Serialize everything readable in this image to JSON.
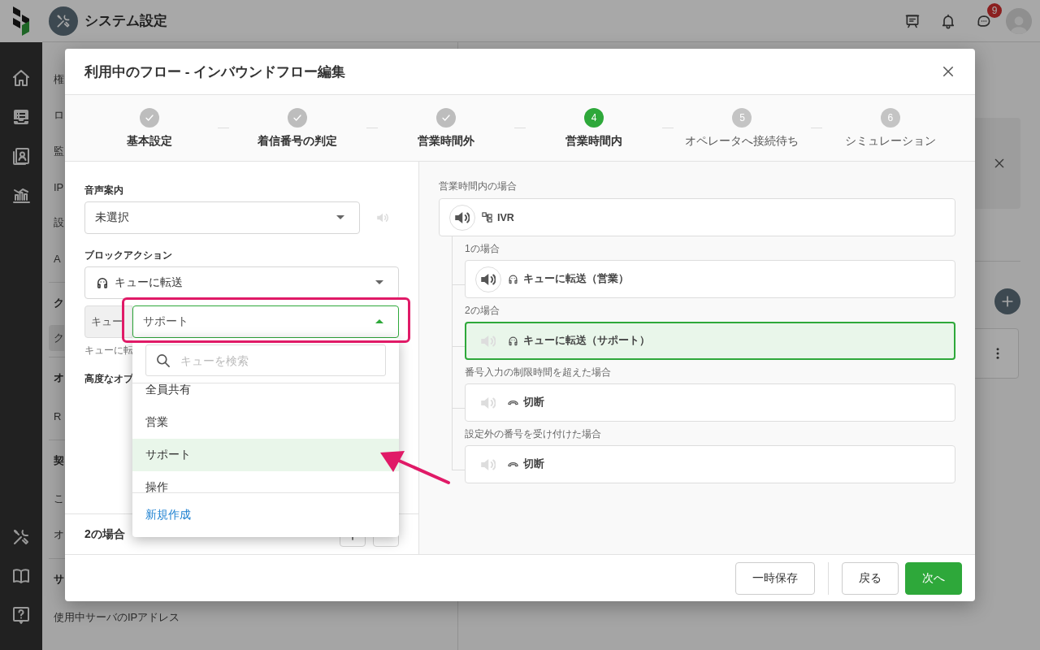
{
  "header": {
    "title": "システム設定",
    "badge": "9"
  },
  "background_sidebar": [
    {
      "label": "権",
      "kind": "item",
      "selected": false
    },
    {
      "label": "ロ",
      "kind": "item",
      "selected": false
    },
    {
      "label": "監",
      "kind": "item",
      "selected": false
    },
    {
      "label": "IP",
      "kind": "item",
      "selected": false
    },
    {
      "label": "設",
      "kind": "item",
      "selected": false
    },
    {
      "label": "A",
      "kind": "item",
      "selected": false
    },
    {
      "label": "ク",
      "kind": "heading"
    },
    {
      "label": "ク",
      "kind": "item",
      "selected": true
    },
    {
      "label": "オ",
      "kind": "heading"
    },
    {
      "label": "R",
      "kind": "item",
      "selected": false
    },
    {
      "label": "契",
      "kind": "heading"
    },
    {
      "label": "こ",
      "kind": "item",
      "selected": false
    },
    {
      "label": "オ",
      "kind": "item",
      "selected": false
    },
    {
      "label": "サ",
      "kind": "heading"
    },
    {
      "label": "使用中サーバのIPアドレス",
      "kind": "item",
      "selected": false
    }
  ],
  "modal": {
    "title": "利用中のフロー - インバウンドフロー編集",
    "steps": [
      {
        "label": "基本設定",
        "completed": true,
        "selected": false
      },
      {
        "label": "着信番号の判定",
        "completed": true,
        "selected": false
      },
      {
        "label": "営業時間外",
        "completed": true,
        "selected": false
      },
      {
        "number": "4",
        "label": "営業時間内",
        "completed": false,
        "selected": true
      },
      {
        "number": "5",
        "label": "オペレータへ接続待ち",
        "completed": false,
        "selected": false
      },
      {
        "number": "6",
        "label": "シミュレーション",
        "completed": false,
        "selected": false
      }
    ],
    "form": {
      "voice_label": "音声案内",
      "voice_select": "未選択",
      "voice_preview_enabled": false,
      "action_label": "ブロックアクション",
      "action_select": {
        "kind": "queue",
        "value": "キューに転送"
      },
      "queue_prefix": "キュー",
      "queue_select": {
        "value": "サポート",
        "open": true
      },
      "queue_help": "キューに転",
      "advanced_label": "高度なオプ",
      "case_footer": "2の場合"
    },
    "dropdown": {
      "placeholder": "キューを検索",
      "options": [
        {
          "label": "全員共有",
          "selected": false
        },
        {
          "label": "営業",
          "selected": false
        },
        {
          "label": "サポート",
          "selected": true
        },
        {
          "label": "操作",
          "selected": false
        }
      ],
      "create_link": "新規作成"
    },
    "flow": {
      "root_label": "営業時間内の場合",
      "root": {
        "kind": "ivr",
        "label": "IVR",
        "audio": true
      },
      "branches": [
        {
          "condition": "1の場合",
          "kind": "queue",
          "label": "キューに転送（営業）",
          "audio": true,
          "selected": false
        },
        {
          "condition": "2の場合",
          "kind": "queue",
          "label": "キューに転送（サポート）",
          "audio": false,
          "selected": true
        },
        {
          "condition": "番号入力の制限時間を超えた場合",
          "kind": "hangup",
          "label": "切断",
          "audio": false,
          "selected": false
        },
        {
          "condition": "設定外の番号を受け付けた場合",
          "kind": "hangup",
          "label": "切断",
          "audio": false,
          "selected": false
        }
      ]
    },
    "buttons": [
      {
        "label": "一時保存",
        "kind": "draft"
      },
      {
        "label": "戻る",
        "kind": "back"
      },
      {
        "label": "次へ",
        "kind": "next"
      }
    ]
  }
}
